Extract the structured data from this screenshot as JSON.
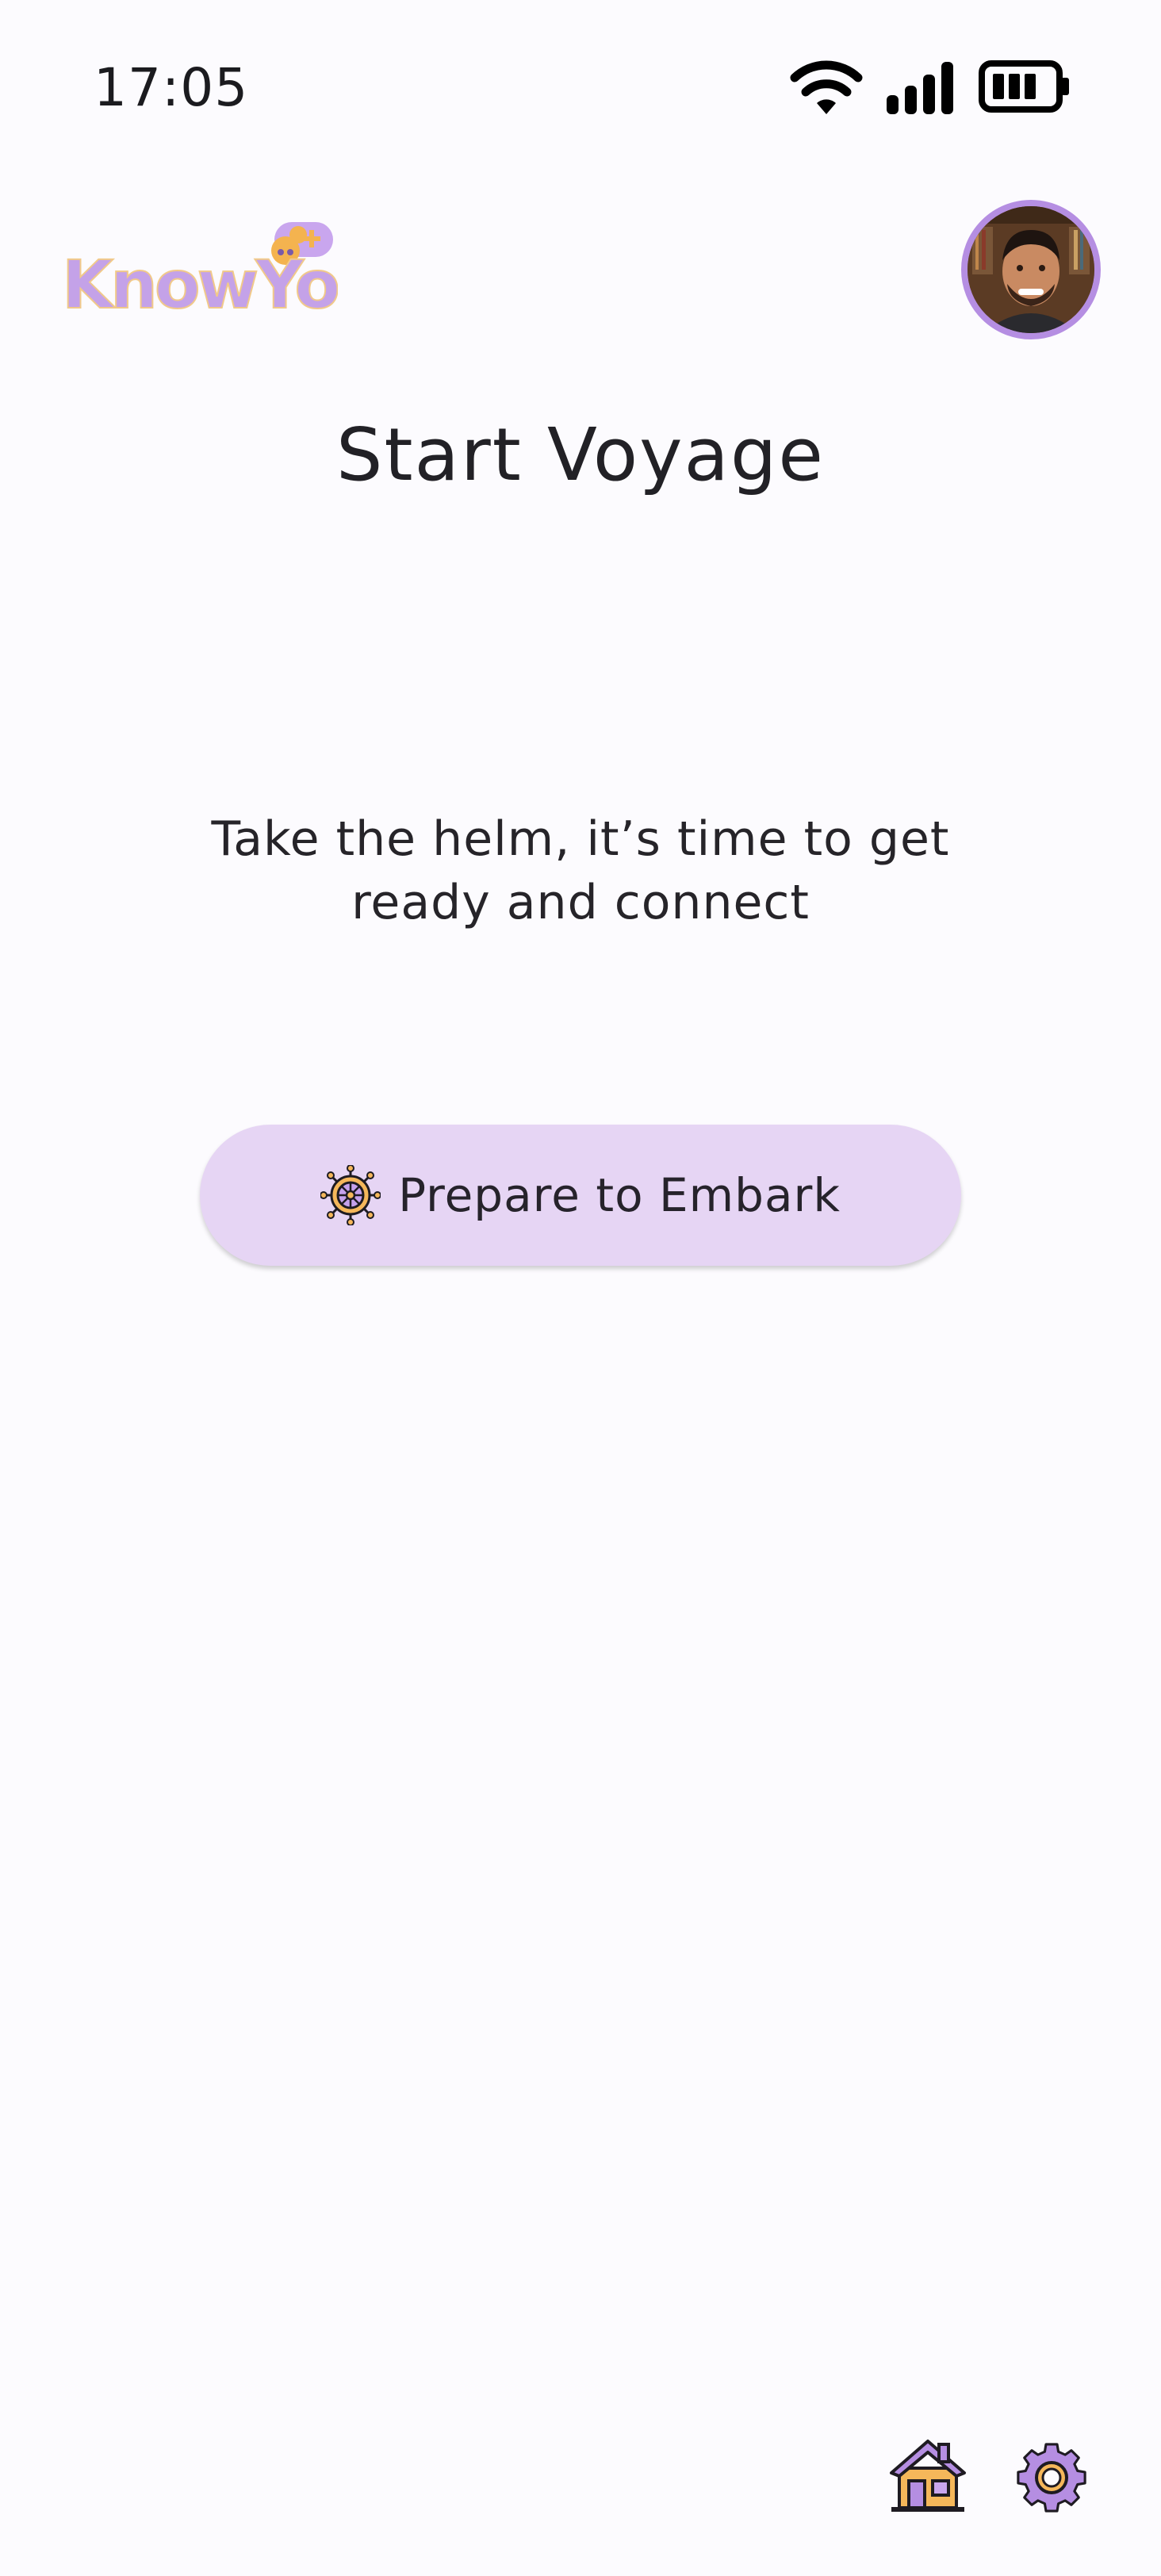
{
  "status_bar": {
    "time": "17:05",
    "icons": [
      "wifi-icon",
      "signal-icon",
      "battery-icon"
    ]
  },
  "header": {
    "logo_text": "KnowYou",
    "avatar_alt": "User profile photo"
  },
  "main": {
    "title": "Start Voyage",
    "subtitle_line1": "Take the helm, it’s time to get",
    "subtitle_line2": "ready and connect",
    "button_label": "Prepare to Embark",
    "button_icon": "ship-wheel-icon"
  },
  "bottom_nav": {
    "items": [
      {
        "icon": "home-icon"
      },
      {
        "icon": "settings-icon"
      }
    ]
  },
  "colors": {
    "background": "#fcfbfe",
    "accent_lavender": "#b58ee2",
    "button_bg": "#e6d5f4",
    "accent_orange": "#f5b75a"
  }
}
